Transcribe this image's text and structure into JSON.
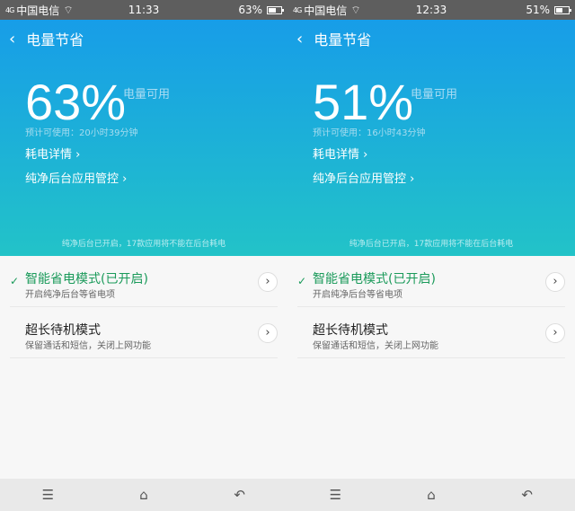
{
  "screens": [
    {
      "carrier": "中国电信",
      "signal": "4G",
      "time": "11:33",
      "battery_text": "63%",
      "battery_level": 63,
      "title": "电量节省",
      "percent": "63%",
      "available_label": "电量可用",
      "estimate": "预计可使用：20小时39分钟",
      "details_link": "耗电详情 ›",
      "bg_link": "纯净后台应用管控 ›",
      "note": "纯净后台已开启，17款应用将不能在后台耗电",
      "modes": [
        {
          "title": "智能省电模式(已开启)",
          "subtitle": "开启纯净后台等省电项",
          "active": true
        },
        {
          "title": "超长待机模式",
          "subtitle": "保留通话和短信，关闭上网功能",
          "active": false
        }
      ]
    },
    {
      "carrier": "中国电信",
      "signal": "4G",
      "time": "12:33",
      "battery_text": "51%",
      "battery_level": 51,
      "title": "电量节省",
      "percent": "51%",
      "available_label": "电量可用",
      "estimate": "预计可使用：16小时43分钟",
      "details_link": "耗电详情 ›",
      "bg_link": "纯净后台应用管控 ›",
      "note": "纯净后台已开启，17款应用将不能在后台耗电",
      "modes": [
        {
          "title": "智能省电模式(已开启)",
          "subtitle": "开启纯净后台等省电项",
          "active": true
        },
        {
          "title": "超长待机模式",
          "subtitle": "保留通话和短信，关闭上网功能",
          "active": false
        }
      ]
    }
  ],
  "icons": {
    "back": "‹",
    "check": "✓",
    "arrow": "›",
    "menu": "☰",
    "home": "⌂",
    "nav_back": "↶"
  }
}
